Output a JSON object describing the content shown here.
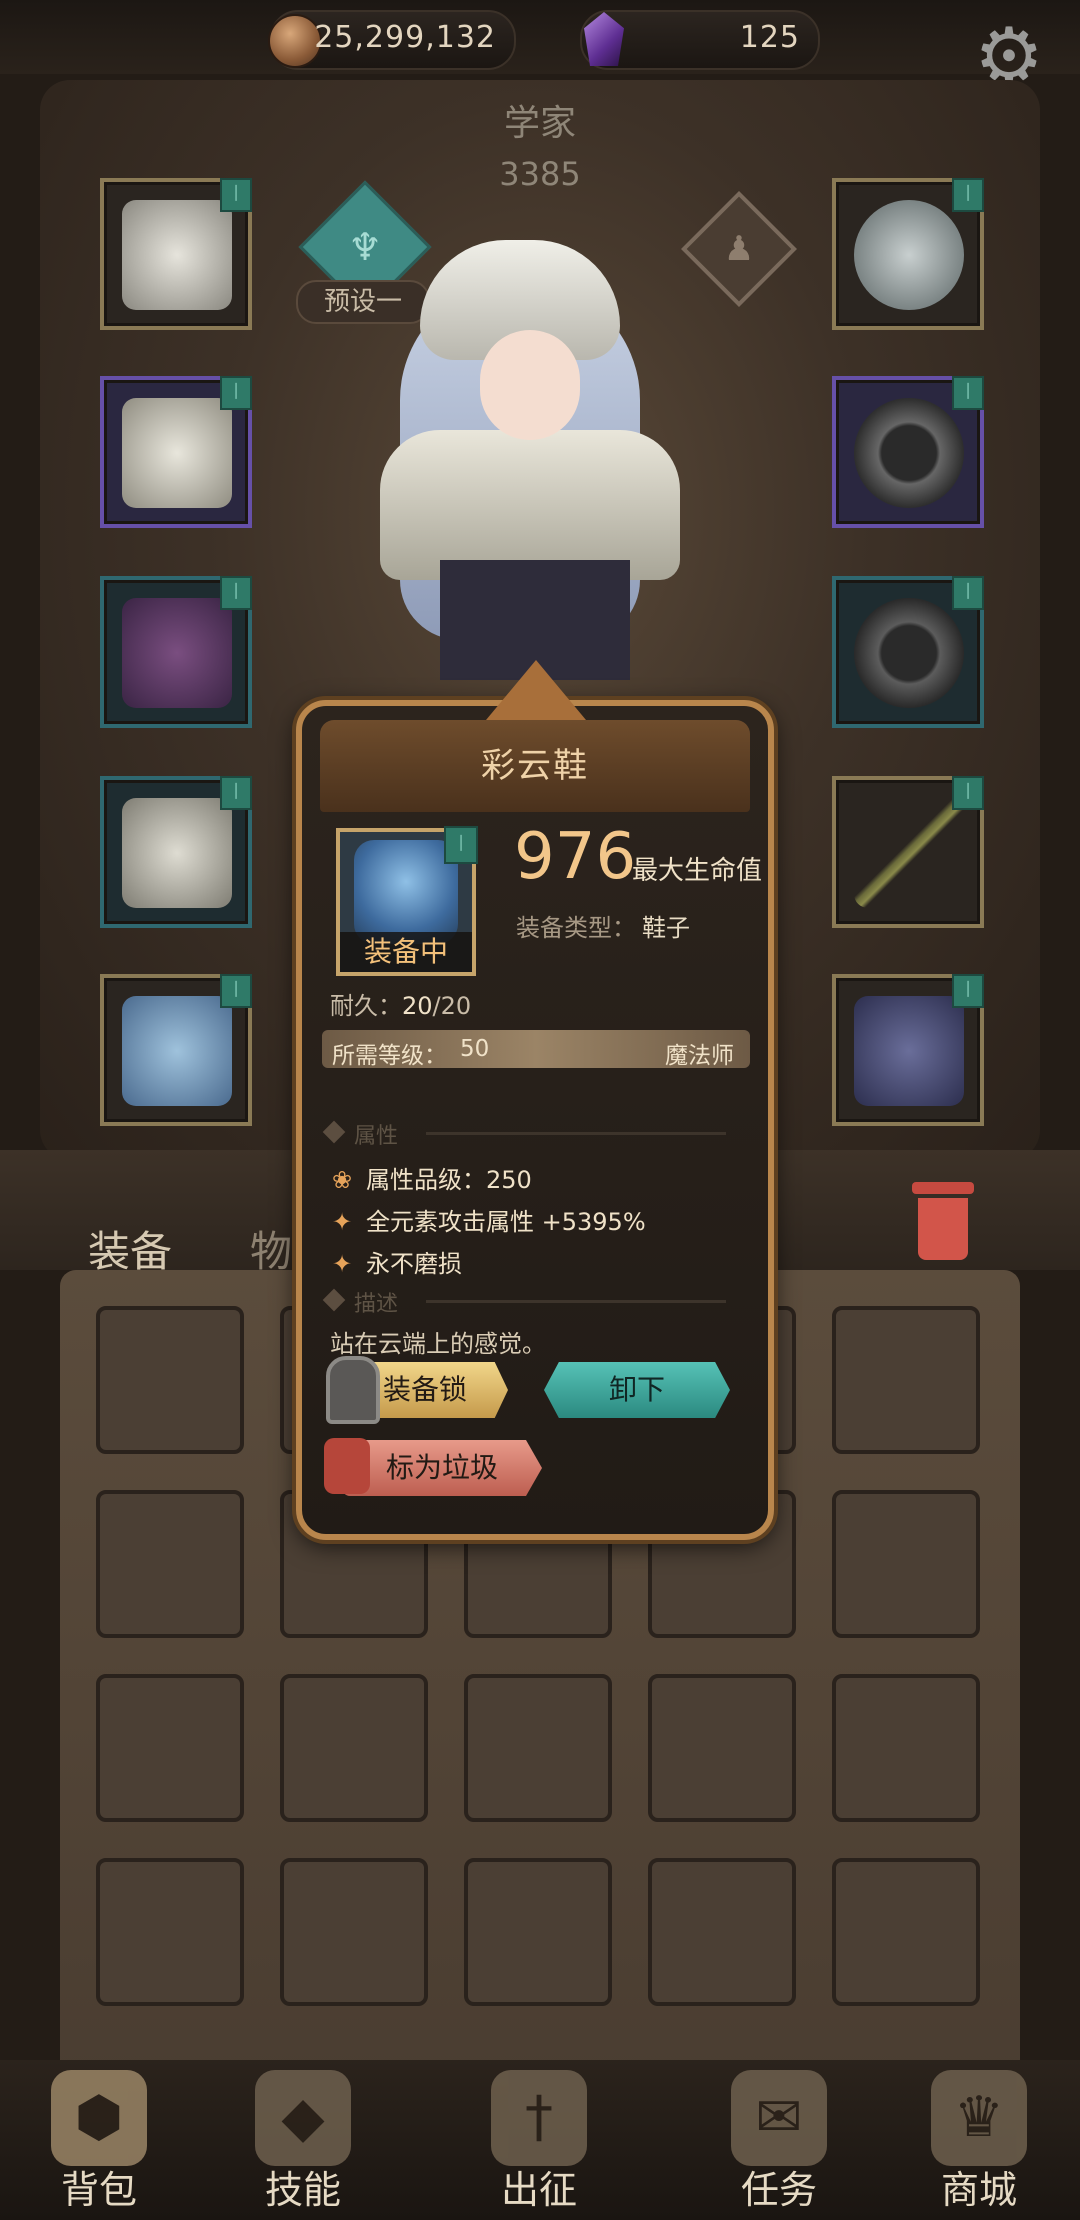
{
  "currency": {
    "coins": "25,299,132",
    "gems": "125"
  },
  "hero": {
    "class_name": "学家",
    "power": "3385",
    "preset_label": "预设一"
  },
  "tabs": {
    "equipment": "装备",
    "items": "物品"
  },
  "item_popup": {
    "title": "彩云鞋",
    "main_stat_value": "976",
    "main_stat_label": "最大生命值",
    "equip_type_label": "装备类型：",
    "equip_type_value": "鞋子",
    "equipped_label": "装备中",
    "durability_label": "耐久：",
    "durability_current": "20",
    "durability_max": "/20",
    "required_level_label": "所需等级：",
    "required_level_value": "50",
    "required_class": "魔法师",
    "attributes_header": "属性",
    "attr_grade": "属性品级：250",
    "attr_bonus": "全元素攻击属性 +5395%",
    "attr_special": "永不磨损",
    "description_header": "描述",
    "description": "站在云端上的感觉。",
    "lock_button": "装备锁",
    "unequip_button": "卸下",
    "junk_button": "标为垃圾"
  },
  "bottom_nav": [
    {
      "label": "背包"
    },
    {
      "label": "技能"
    },
    {
      "label": "出征"
    },
    {
      "label": "任务"
    },
    {
      "label": "商城"
    }
  ],
  "colors": {
    "accent_gold": "#f2c68a",
    "teal_button": "#2b8a80",
    "junk_red": "#bd5e50"
  }
}
